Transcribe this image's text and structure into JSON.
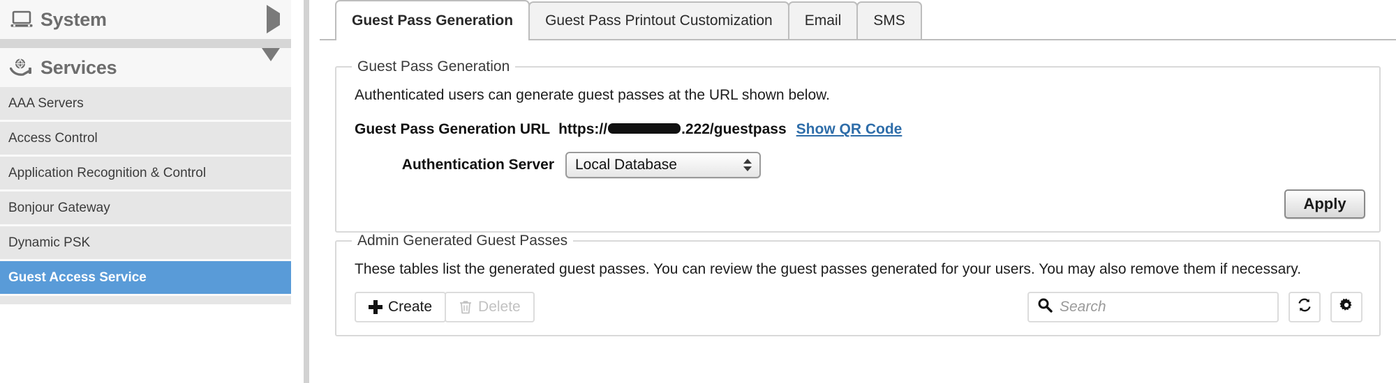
{
  "sidebar": {
    "groups": [
      {
        "label": "System",
        "icon": "laptop-icon",
        "arrow": "chevron-right-icon",
        "expanded": false
      },
      {
        "label": "Services",
        "icon": "services-hand-globe-icon",
        "arrow": "chevron-down-icon",
        "expanded": true
      }
    ],
    "items": [
      {
        "label": "AAA Servers",
        "selected": false
      },
      {
        "label": "Access Control",
        "selected": false
      },
      {
        "label": "Application Recognition & Control",
        "selected": false
      },
      {
        "label": "Bonjour Gateway",
        "selected": false
      },
      {
        "label": "Dynamic PSK",
        "selected": false
      },
      {
        "label": "Guest Access Service",
        "selected": true
      }
    ],
    "selected_color": "#599bd8"
  },
  "tabs": [
    {
      "label": "Guest Pass Generation",
      "active": true
    },
    {
      "label": "Guest Pass Printout Customization",
      "active": false
    },
    {
      "label": "Email",
      "active": false
    },
    {
      "label": "SMS",
      "active": false
    }
  ],
  "generation_panel": {
    "legend": "Guest Pass Generation",
    "description": "Authenticated users can generate guest passes at the URL shown below.",
    "url_label": "Guest Pass Generation URL",
    "url_prefix": "https://",
    "url_redacted": true,
    "url_suffix": ".222/guestpass",
    "qr_link": "Show QR Code",
    "auth_server_label": "Authentication Server",
    "auth_server_value": "Local Database",
    "apply_label": "Apply"
  },
  "admin_panel": {
    "legend": "Admin Generated Guest Passes",
    "description": "These tables list the generated guest passes. You can review the guest passes generated for your users. You may also remove them if necessary.",
    "create_label": "Create",
    "delete_label": "Delete",
    "delete_disabled": true,
    "search_placeholder": "Search",
    "search_value": "",
    "refresh_icon": "refresh-icon",
    "settings_icon": "gear-icon"
  },
  "colors": {
    "accent": "#599bd8",
    "link": "#2e6da9",
    "nav_item_bg": "#e6e6e6",
    "group_header_bg": "#f7f7f7"
  }
}
